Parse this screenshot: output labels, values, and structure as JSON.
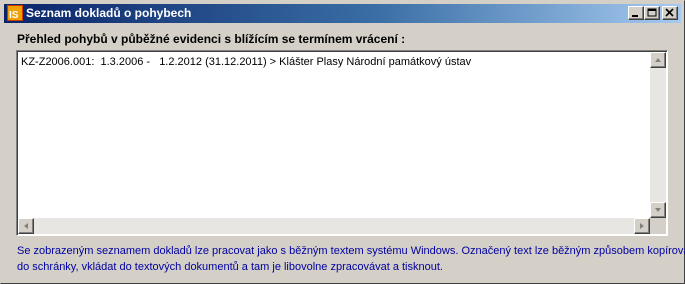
{
  "window": {
    "title": "Seznam dokladů o pohybech",
    "icon_name": "is-app-icon",
    "buttons": [
      "minimize-icon",
      "maximize-icon",
      "close-icon"
    ]
  },
  "header": {
    "label": "Přehled pohybů v půběžné evidenci s blížícím se termínem vrácení :"
  },
  "list": {
    "lines": [
      "KZ-Z2006.001:  1.3.2006 -   1.2.2012 (31.12.2011) > Klášter Plasy Národní památkový ústav"
    ]
  },
  "footer": {
    "line1": "Se zobrazeným seznamem dokladů lze pracovat jako s běžným textem systému Windows. Označený text lze běžným způsobem kopírovat",
    "line2": "do schránky, vkládat do textových dokumentů a tam je libovolne zpracovávat a tisknout."
  },
  "colors": {
    "titlebar_start": "#0a246a",
    "titlebar_end": "#a6caf0",
    "footer_text": "#0000a0",
    "face": "#d4d0c8"
  }
}
